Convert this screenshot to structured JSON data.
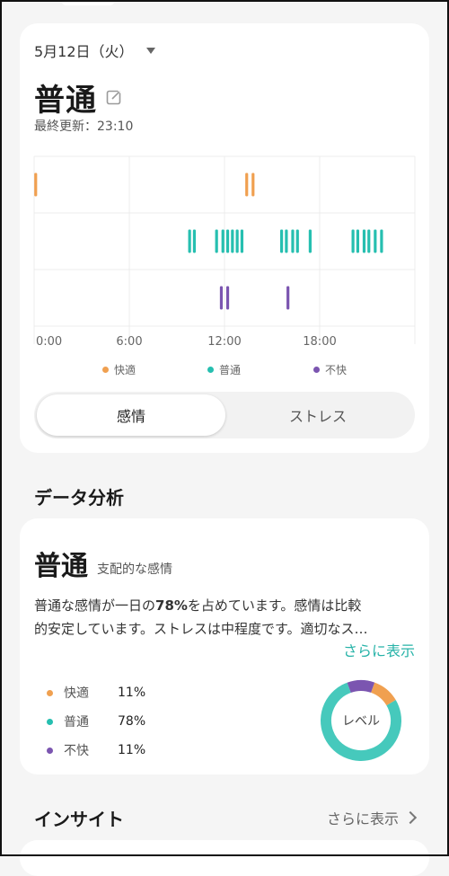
{
  "header": {
    "date": "5月12日（火）",
    "mood": "普通",
    "last_updated": "最終更新：23:10"
  },
  "chart_data": {
    "type": "scatter",
    "rows": [
      "快適",
      "普通",
      "不快"
    ],
    "x_ticks": [
      "0:00",
      "6:00",
      "12:00",
      "18:00"
    ],
    "xlim": [
      0,
      24
    ],
    "points": {
      "快適": [
        0.1,
        13.4,
        13.8
      ],
      "普通": [
        9.8,
        10.1,
        11.5,
        11.9,
        12.2,
        12.5,
        12.8,
        13.1,
        15.6,
        15.9,
        16.3,
        16.6,
        17.4,
        20.1,
        20.4,
        20.8,
        21.1,
        21.5,
        21.9
      ],
      "不快": [
        11.8,
        12.2,
        16.0
      ]
    },
    "colors": {
      "快適": "#f0a050",
      "普通": "#26bfb0",
      "不快": "#7b55b0"
    }
  },
  "legend": [
    {
      "label": "快適",
      "color": "#f0a050"
    },
    {
      "label": "普通",
      "color": "#26bfb0"
    },
    {
      "label": "不快",
      "color": "#7b55b0"
    }
  ],
  "toggle": {
    "active": "感情",
    "inactive": "ストレス"
  },
  "data_analysis": {
    "heading": "データ分析",
    "dominant_mood": "普通",
    "dominant_label": "支配的な感情",
    "summary_prefix": "普通な感情が一日の",
    "summary_bold": "78%",
    "summary_suffix": "を占めています。感情は比較",
    "summary_line2": "的安定しています。ストレスは中程度です。適切なス…",
    "more_link": "さらに表示",
    "stats": [
      {
        "label": "快適",
        "percent": "11%",
        "value": 11,
        "color": "#f0a050"
      },
      {
        "label": "普通",
        "percent": "78%",
        "value": 78,
        "color": "#26bfb0"
      },
      {
        "label": "不快",
        "percent": "11%",
        "value": 11,
        "color": "#7b55b0"
      }
    ],
    "donut_label": "レベル"
  },
  "insight": {
    "heading": "インサイト",
    "more_link": "さらに表示"
  }
}
